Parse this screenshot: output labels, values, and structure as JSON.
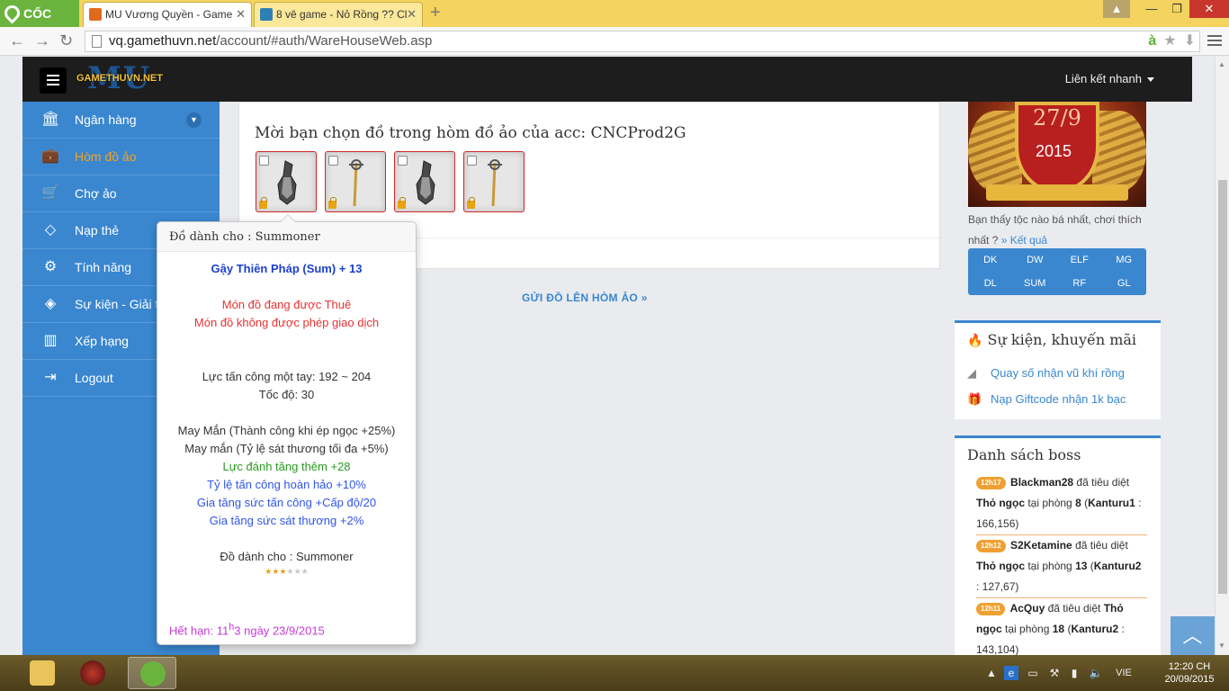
{
  "browser": {
    "logo_text": "CỐC CỐC",
    "tabs": [
      {
        "label": "MU Vương Quyền - Game"
      },
      {
        "label": "8 vê game - Nỏ Rồng ?? Cl"
      }
    ],
    "new_tab": "+",
    "url_host": "vq.gamethuvn.net",
    "url_path": "/account/#auth/WareHouseWeb.asp"
  },
  "header": {
    "logo_mu": "MU",
    "logo_site": "GAMETHUVN.NET",
    "quick_links": "Liên kết nhanh"
  },
  "sidebar": {
    "items": [
      {
        "label": "Ngân hàng",
        "icon": "bank-icon"
      },
      {
        "label": "Hòm đồ ảo",
        "icon": "briefcase-icon"
      },
      {
        "label": "Chợ ảo",
        "icon": "cart-icon"
      },
      {
        "label": "Nạp thẻ",
        "icon": "diamond-icon"
      },
      {
        "label": "Tính năng",
        "icon": "gears-icon"
      },
      {
        "label": "Sự kiện - Giải thưởng",
        "icon": "event-icon"
      },
      {
        "label": "Xếp hạng",
        "icon": "chart-icon"
      },
      {
        "label": "Logout",
        "icon": "logout-icon"
      }
    ]
  },
  "main": {
    "title": "Mời bạn chọn đồ trong hòm đồ ảo của acc: CNCProd2G",
    "send_link": "GỬI ĐỒ LÊN HÒM ẢO  »"
  },
  "tooltip": {
    "header": "Đồ dành cho : Summoner",
    "item_name": "Gậy Thiên Pháp (Sum) + 13",
    "rent_status": "Món đồ đang được Thuê",
    "no_trade": "Món đồ không được phép giao dịch",
    "attack": "Lực tấn công một tay: 192 ~ 204",
    "speed": "Tốc độ: 30",
    "luck1": "May Mắn (Thành công khi ép ngọc +25%)",
    "luck2": "May mắn (Tỷ lệ sát thương tối đa +5%)",
    "opt1": "Lực đánh tăng thêm +28",
    "opt2": "Tỷ lệ tấn công hoàn hảo +10%",
    "opt3": "Gia tăng sức tấn công +Cấp độ/20",
    "opt4": "Gia tăng sức sát thương +2%",
    "class_for": "Đồ dành cho : Summoner",
    "expiry_prefix": "Hết hạn: 11",
    "expiry_sup": "h",
    "expiry_suffix": "3 ngày 23/9/2015",
    "stars_filled": 3,
    "stars_total": 6
  },
  "right": {
    "banner_date": "27/9",
    "banner_year": "2015",
    "poll_text": "Bạn thấy tộc nào bá nhất, chơi thích nhất ?",
    "poll_result": "» Kết quả",
    "poll_options": [
      "DK",
      "DW",
      "ELF",
      "MG",
      "DL",
      "SUM",
      "RF",
      "GL"
    ],
    "events_title": "Sự kiện, khuyến mãi",
    "events": [
      {
        "label": "Quay số nhận vũ khí rồng",
        "icon": "wing-icon"
      },
      {
        "label": "Nạp Giftcode nhận 1k bạc",
        "icon": "gift-icon"
      }
    ],
    "boss_title": "Danh sách boss",
    "bosses": [
      {
        "time": "12h17",
        "player": "Blackman28",
        "text1": "đã tiêu diệt",
        "boss": "Thỏ ngọc",
        "text2": "tại phòng",
        "room": "8",
        "server": "Kanturu1",
        "coords": " : 166,156)"
      },
      {
        "time": "12h12",
        "player": "S2Ketamine",
        "text1": "đã tiêu diệt",
        "boss": "Thỏ ngọc",
        "text2": "tại phòng",
        "room": "13",
        "server": "Kanturu2",
        "coords": " : 127,67)"
      },
      {
        "time": "12h11",
        "player": "AcQuy",
        "text1": "đã tiêu diệt",
        "boss": "Thỏ ngọc",
        "text2": "tại phòng",
        "room": "18",
        "server": "Kanturu2",
        "coords": " : 143,104)"
      }
    ]
  },
  "taskbar": {
    "lang": "VIE",
    "time": "12:20 CH",
    "date": "20/09/2015"
  },
  "colors": {
    "sidebar_bg": "#3a87d0",
    "active_orange": "#f6a21f",
    "slot_border": "#d0282a",
    "link_blue": "#3a87d0"
  }
}
